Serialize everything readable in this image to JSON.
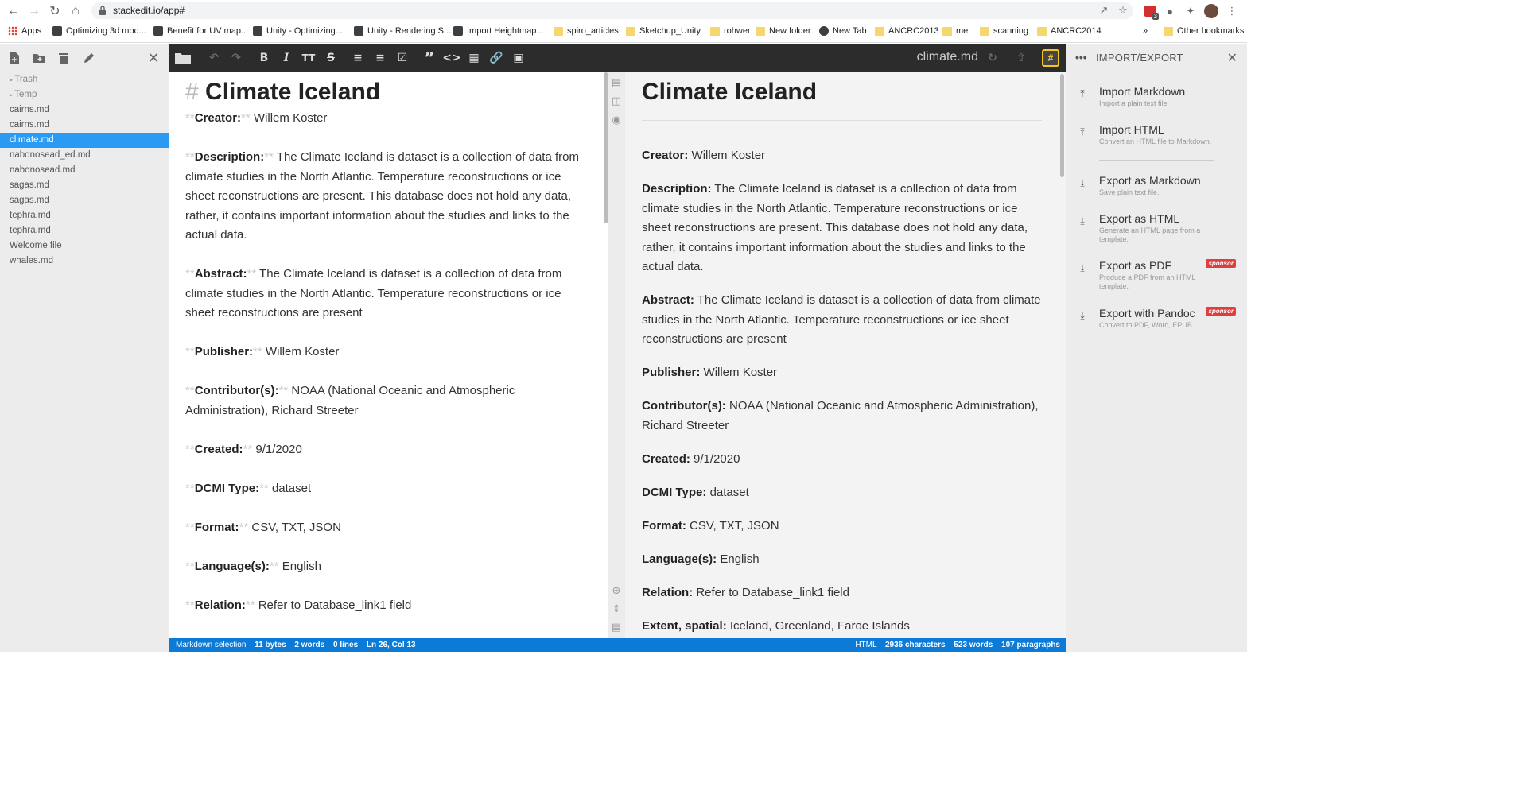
{
  "browser": {
    "url": "stackedit.io/app#",
    "bookmarks": [
      {
        "label": "Apps",
        "icon": "apps"
      },
      {
        "label": "Optimizing 3d mod...",
        "icon": "site"
      },
      {
        "label": "Benefit for UV map...",
        "icon": "site"
      },
      {
        "label": "Unity - Optimizing...",
        "icon": "site"
      },
      {
        "label": "Unity - Rendering S...",
        "icon": "site"
      },
      {
        "label": "Import Heightmap...",
        "icon": "site"
      },
      {
        "label": "spiro_articles",
        "icon": "folder"
      },
      {
        "label": "Sketchup_Unity",
        "icon": "folder"
      },
      {
        "label": "rohwer",
        "icon": "folder"
      },
      {
        "label": "New folder",
        "icon": "folder"
      },
      {
        "label": "New Tab",
        "icon": "globe"
      },
      {
        "label": "ANCRC2013",
        "icon": "folder"
      },
      {
        "label": "me",
        "icon": "folder"
      },
      {
        "label": "scanning",
        "icon": "folder"
      },
      {
        "label": "ANCRC2014",
        "icon": "folder"
      }
    ],
    "more_bookmarks": "»",
    "other_bookmarks": "Other bookmarks",
    "extension_badge": "3"
  },
  "explorer": {
    "files": [
      {
        "name": "Trash",
        "type": "folder"
      },
      {
        "name": "Temp",
        "type": "folder"
      },
      {
        "name": "cairns.md",
        "type": "file"
      },
      {
        "name": "cairns.md",
        "type": "file"
      },
      {
        "name": "climate.md",
        "type": "file",
        "active": true
      },
      {
        "name": "nabonosead_ed.md",
        "type": "file"
      },
      {
        "name": "nabonosead.md",
        "type": "file"
      },
      {
        "name": "sagas.md",
        "type": "file"
      },
      {
        "name": "sagas.md",
        "type": "file"
      },
      {
        "name": "tephra.md",
        "type": "file"
      },
      {
        "name": "tephra.md",
        "type": "file"
      },
      {
        "name": "Welcome file",
        "type": "file"
      },
      {
        "name": "whales.md",
        "type": "file"
      }
    ]
  },
  "navbar": {
    "doc_title": "climate.md",
    "hash_label": "#"
  },
  "document": {
    "heading_mark": "#",
    "title": "Climate Iceland",
    "bold_mark": "**",
    "fields": [
      {
        "key": "Creator:",
        "value": "Willem Koster"
      },
      {
        "key": "Description:",
        "value": "The Climate Iceland is dataset is a collection of data from climate studies in the North Atlantic. Temperature reconstructions or ice sheet reconstructions are present. This database does not hold any data, rather, it contains important information about the studies and links to the actual data."
      },
      {
        "key": "Abstract:",
        "value": "The Climate Iceland is dataset is a collection of data from climate studies in the North Atlantic. Temperature reconstructions or ice sheet reconstructions are present"
      },
      {
        "key": "Publisher:",
        "value": "Willem Koster"
      },
      {
        "key": "Contributor(s):",
        "value": "NOAA (National Oceanic and Atmospheric Administration), Richard Streeter"
      },
      {
        "key": "Created:",
        "value": "9/1/2020"
      },
      {
        "key": "DCMI Type:",
        "value": "dataset"
      },
      {
        "key": "Format:",
        "value": "CSV, TXT, JSON"
      },
      {
        "key": "Language(s):",
        "value": "English"
      },
      {
        "key": "Relation:",
        "value": "Refer to Database_link1 field"
      },
      {
        "key": "Extent, spatial:",
        "value": "Iceland, Greenland, Faroe Islands"
      }
    ]
  },
  "status": {
    "left_label": "Markdown selection",
    "bytes": "11 bytes",
    "words": "2 words",
    "lines": "0 lines",
    "position": "Ln 26, Col 13",
    "right_label": "HTML",
    "characters": "2936 characters",
    "total_words": "523 words",
    "paragraphs": "107 paragraphs"
  },
  "panel": {
    "menu_icon": "•••",
    "title": "IMPORT/EXPORT",
    "items": [
      {
        "title": "Import Markdown",
        "subtitle": "Import a plain text file.",
        "sponsor": ""
      },
      {
        "title": "Import HTML",
        "subtitle": "Convert an HTML file to Markdown.",
        "sponsor": ""
      },
      {
        "title": "Export as Markdown",
        "subtitle": "Save plain text file.",
        "sponsor": ""
      },
      {
        "title": "Export as HTML",
        "subtitle": "Generate an HTML page from a template.",
        "sponsor": ""
      },
      {
        "title": "Export as PDF",
        "subtitle": "Produce a PDF from an HTML template.",
        "sponsor": "sponsor"
      },
      {
        "title": "Export with Pandoc",
        "subtitle": "Convert to PDF, Word, EPUB...",
        "sponsor": "sponsor"
      }
    ]
  },
  "colors": {
    "accent": "#2b9af3",
    "statusbar": "#0c7bd8",
    "navbar": "#2c2c2c",
    "sponsor": "#e03d3d"
  }
}
